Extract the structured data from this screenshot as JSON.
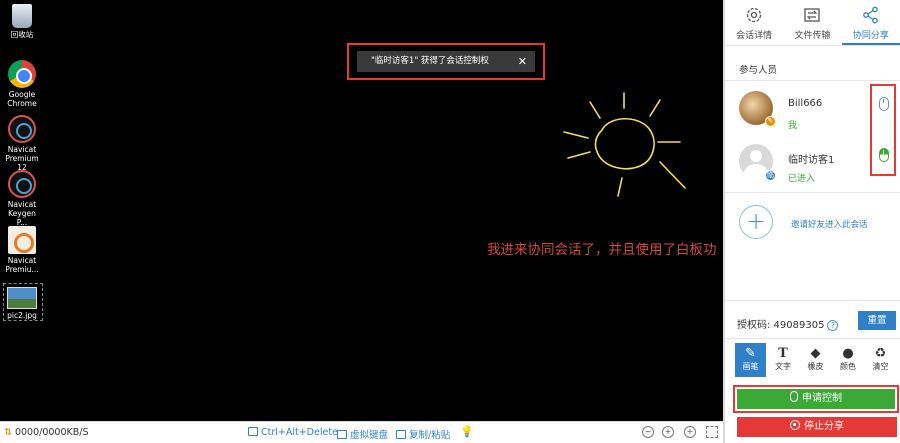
{
  "desktop": {
    "icons": [
      {
        "label": "回收站"
      },
      {
        "label": "Google\nChrome"
      },
      {
        "label": "Navicat\nPremium 12"
      },
      {
        "label": "Navicat\nKeygen P..."
      },
      {
        "label": "Navicat\nPremiu..."
      },
      {
        "label": "pic2.jpg"
      }
    ]
  },
  "toast": {
    "message": "\"临时访客1\" 获得了会话控制权",
    "close": "✕"
  },
  "whiteboard": {
    "text": "我进来协同会话了，并且使用了白板功",
    "color": "#d04a3c",
    "sun_color": "#f5e04a"
  },
  "statusbar": {
    "speed_arrows": "⇅",
    "speed": "0000/0000KB/S",
    "ctrl_alt_del": "Ctrl+Alt+Delete",
    "virtual_keyboard": "虚拟键盘",
    "copy_paste": "复制/粘贴",
    "bulb": "💡",
    "zoom_out": "−",
    "zoom_in": "+"
  },
  "panel": {
    "tabs": [
      {
        "label": "会话详情"
      },
      {
        "label": "文件传输"
      },
      {
        "label": "协同分享"
      }
    ],
    "participants_title": "参与人员",
    "participants": [
      {
        "name": "Bill666",
        "status": "我",
        "badge": "✎"
      },
      {
        "name": "临时访客1",
        "status": "已进入",
        "badge": "临"
      }
    ],
    "invite_plus": "+",
    "invite_label": "邀请好友进入此会话",
    "auth_code_label": "授权码: 49089305",
    "auth_help": "?",
    "reset_label": "重置",
    "tools": [
      {
        "label": "画笔",
        "glyph": "✎"
      },
      {
        "label": "文字",
        "glyph": "T"
      },
      {
        "label": "橡皮",
        "glyph": "◆"
      },
      {
        "label": "颜色",
        "glyph": "●"
      },
      {
        "label": "清空",
        "glyph": "♻"
      }
    ],
    "request_control": "申请控制",
    "stop_share": "停止分享"
  },
  "colors": {
    "accent": "#2f80c8",
    "green": "#3aa935",
    "red": "#e53935"
  }
}
